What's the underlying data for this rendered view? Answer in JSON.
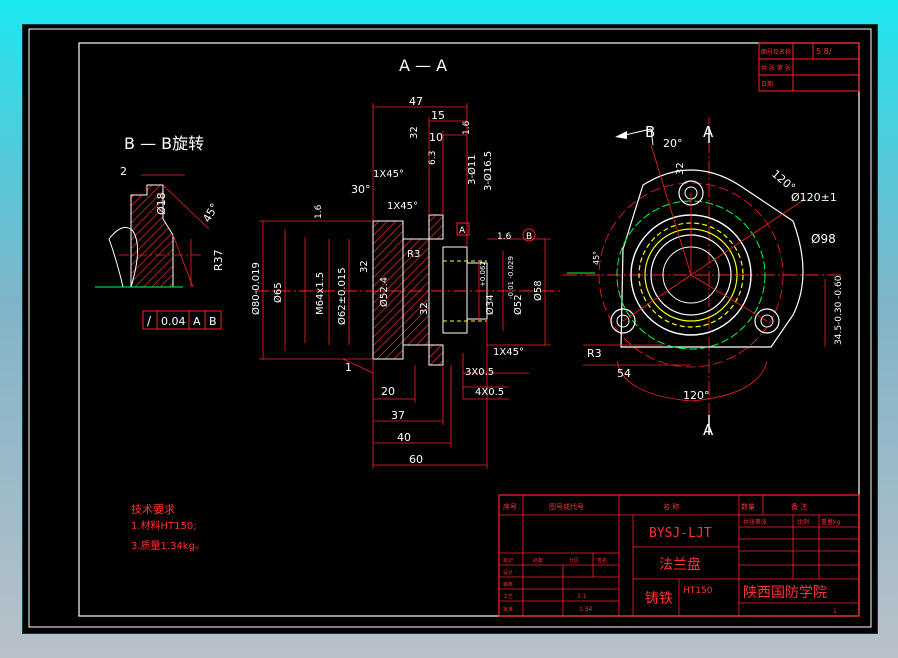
{
  "views": {
    "section_title": "A — A",
    "detail_title": "B — B旋转",
    "cut_marks": {
      "a_top": "A",
      "a_bottom": "A",
      "b": "B"
    }
  },
  "colors": {
    "background": "#000000",
    "frame": "#ffffff",
    "dimension": "#ff2020",
    "centerline": "#ff2020",
    "hidden": "#ffff00",
    "green_line": "#00ff40",
    "hatch": "#ff3030",
    "outer_glow": "#22e6f0"
  },
  "detail_b": {
    "dims": [
      "2",
      "Ø18",
      "45°",
      "R37"
    ]
  },
  "tolerance_frame": {
    "symbol": "/",
    "value": "0.04",
    "datum1": "A",
    "datum2": "B"
  },
  "section_view": {
    "top_dims": [
      "47",
      "32",
      "15",
      "1.6",
      "10",
      "6.3",
      "3-Ø11",
      "3-Ø16.5",
      "1X45°",
      "1X45°",
      "30°",
      "1.6"
    ],
    "datums": [
      "A",
      "B"
    ],
    "left_dims": [
      "Ø80-0.019",
      "Ø65",
      "M64x1.5",
      "Ø62±0.015",
      "Ø52.4",
      "32",
      "R3"
    ],
    "right_dims": [
      "32",
      "Ø34",
      "+0.062",
      "Ø52",
      "-0.01 -0.029",
      "Ø58",
      "1.6"
    ],
    "bottom_dims": [
      "1X45°",
      "3X0.5",
      "4X0.5",
      "1",
      "20",
      "37",
      "40",
      "60"
    ]
  },
  "plan_view": {
    "angles": [
      "20°",
      "120°",
      "120°"
    ],
    "dims": [
      "32",
      "Ø120±1",
      "Ø98",
      "34.5-0.30 -0.60",
      "R3",
      "54",
      "45°"
    ]
  },
  "notes": {
    "heading": "技术要求",
    "lines": [
      "1.材料HT150;",
      "3.质量1.34kg。"
    ]
  },
  "top_right_box": {
    "rows": [
      "图号及名称",
      "共  张  第  张",
      "日期"
    ],
    "mark": "5  8/"
  },
  "title_block": {
    "header": [
      "序号",
      "图号或代号",
      "名  称",
      "数量",
      "备  注"
    ],
    "drawing_no": "BYSJ-LJT",
    "part_name": "法兰盘",
    "material_label": "铸铁",
    "material": "HT150",
    "school": "陕西国防学院",
    "right_small": [
      "共张第张",
      "比例",
      "重量kg"
    ],
    "left_rows": [
      "标记",
      "处数",
      "分区",
      "签名",
      "设计",
      "审核",
      "工艺",
      "批准"
    ],
    "scale": "1:1",
    "mass": "1.34",
    "sheet": "1"
  }
}
